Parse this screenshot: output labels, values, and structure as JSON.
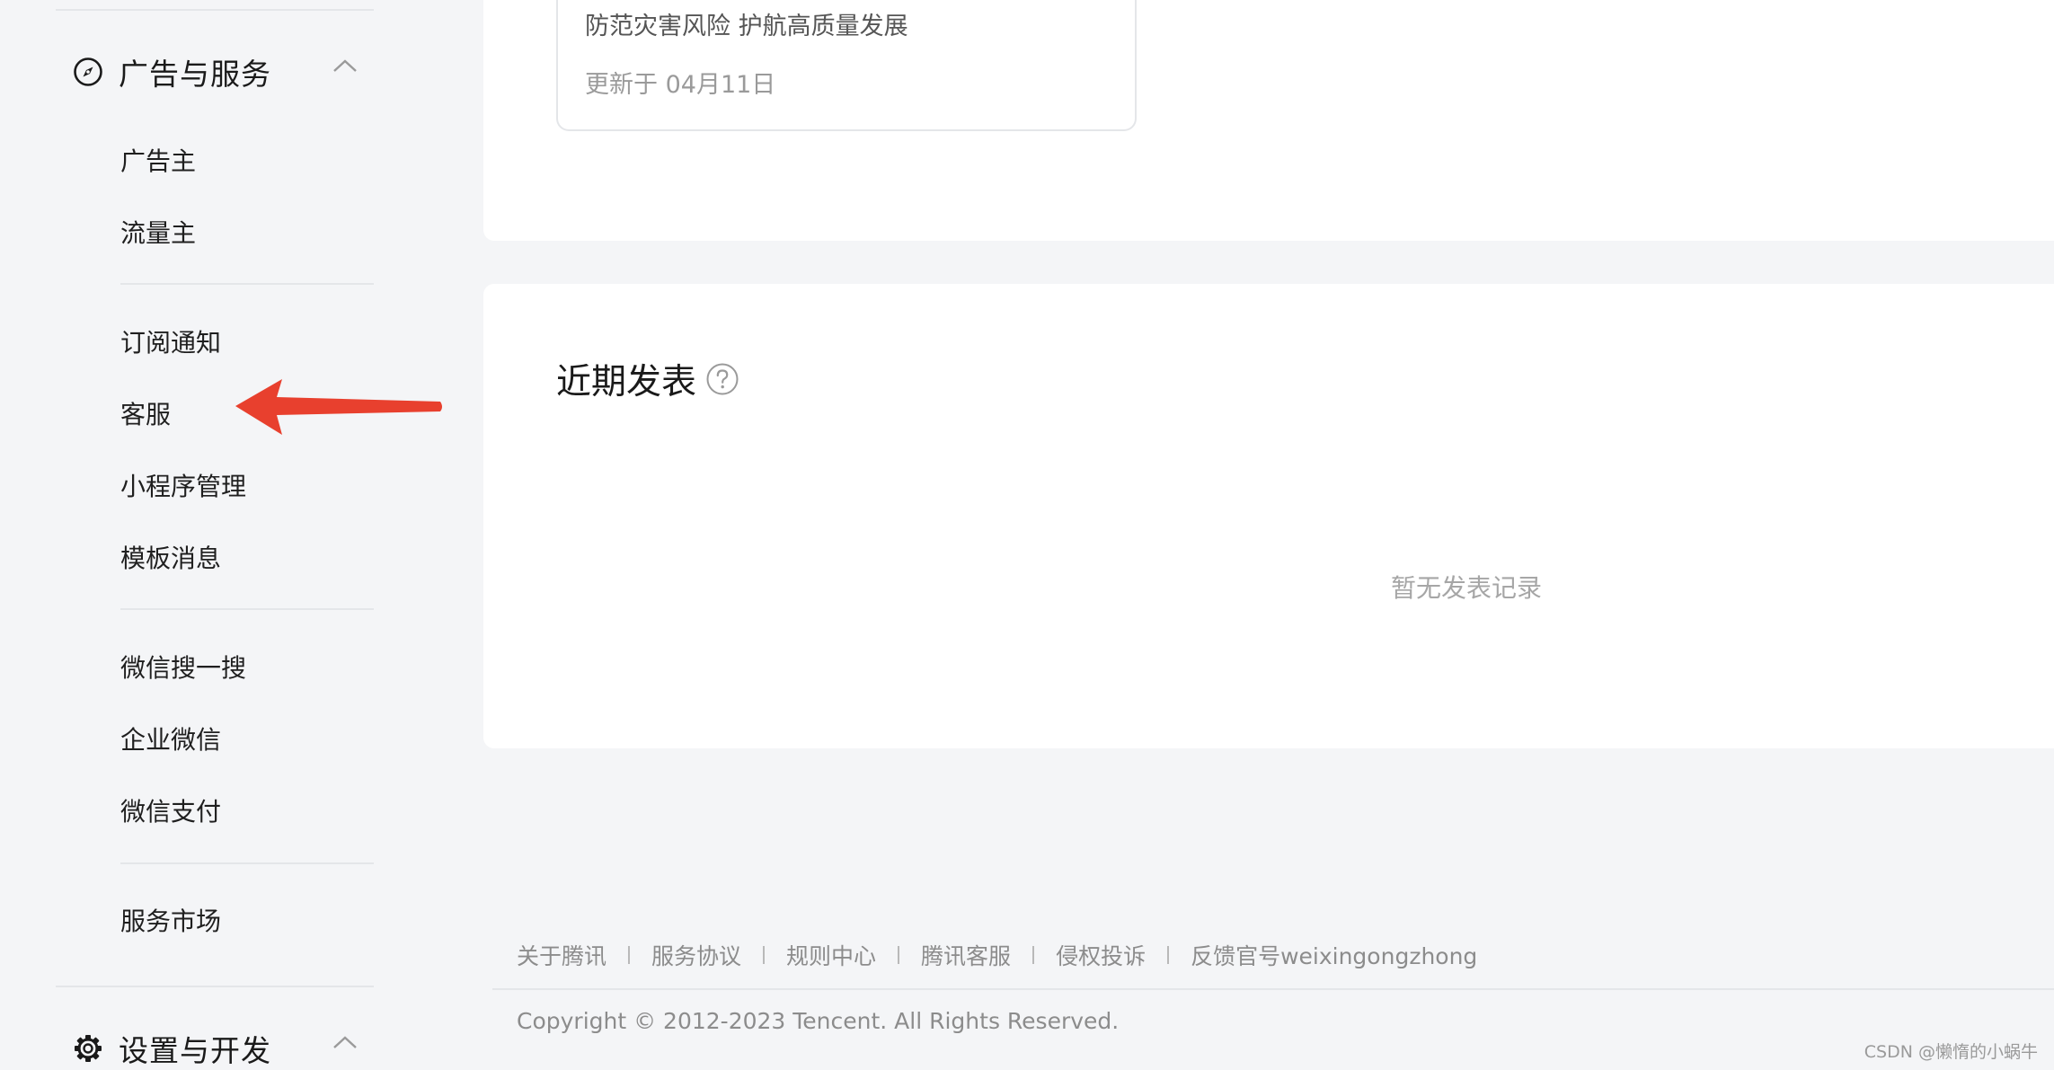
{
  "sidebar": {
    "sections": [
      {
        "title": "广告与服务",
        "icon": "compass-icon",
        "expanded": true
      },
      {
        "title": "设置与开发",
        "icon": "gear-icon",
        "expanded": true
      }
    ],
    "ad_items": [
      {
        "label": "广告主"
      },
      {
        "label": "流量主"
      }
    ],
    "service_items": [
      {
        "label": "订阅通知"
      },
      {
        "label": "客服"
      },
      {
        "label": "小程序管理"
      },
      {
        "label": "模板消息"
      }
    ],
    "wechat_items": [
      {
        "label": "微信搜一搜"
      },
      {
        "label": "企业微信"
      },
      {
        "label": "微信支付"
      }
    ],
    "market_items": [
      {
        "label": "服务市场"
      }
    ]
  },
  "article": {
    "title": "防范灾害风险 护航高质量发展",
    "updated": "更新于 04月11日"
  },
  "recent": {
    "title": "近期发表",
    "empty_text": "暂无发表记录"
  },
  "footer": {
    "links": [
      {
        "label": "关于腾讯"
      },
      {
        "label": "服务协议"
      },
      {
        "label": "规则中心"
      },
      {
        "label": "腾讯客服"
      },
      {
        "label": "侵权投诉"
      },
      {
        "label": "反馈官号weixingongzhong"
      }
    ],
    "copyright": "Copyright © 2012-2023 Tencent. All Rights Reserved."
  },
  "watermark": "CSDN @懒惰的小蜗牛",
  "colors": {
    "background": "#f4f5f7",
    "card": "#ffffff",
    "annotation_arrow": "#e8402e"
  }
}
